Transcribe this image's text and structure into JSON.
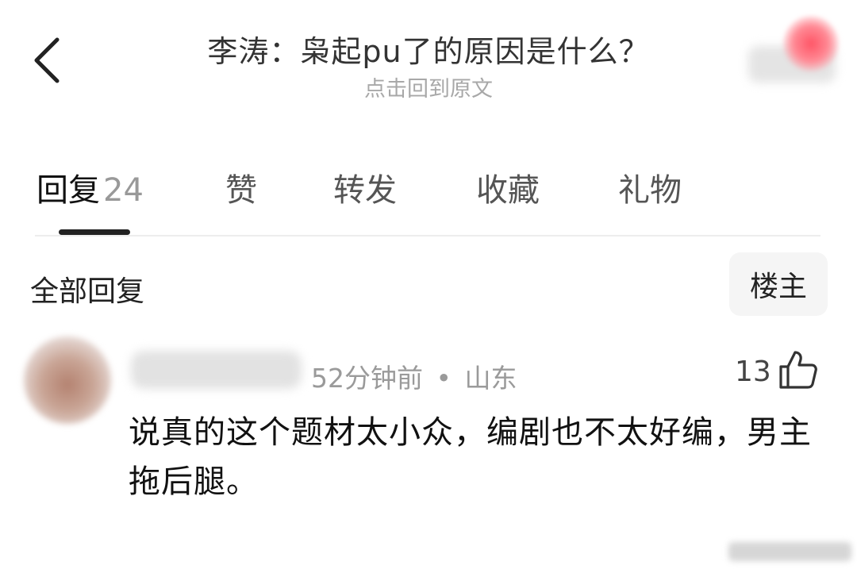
{
  "header": {
    "title": "李涛：枭起pu了的原因是什么？",
    "subtitle": "点击回到原文"
  },
  "tabs": [
    {
      "label": "回复",
      "count": "24"
    },
    {
      "label": "赞"
    },
    {
      "label": "转发"
    },
    {
      "label": "收藏"
    },
    {
      "label": "礼物"
    }
  ],
  "section": {
    "title": "全部回复",
    "op_filter": "楼主"
  },
  "comment": {
    "time": "52分钟前",
    "separator": "•",
    "location": "山东",
    "likes": "13",
    "text": "说真的这个题材太小众，编剧也不太好编，男主拖后腿。"
  },
  "icons": {
    "back": "chevron-left-icon",
    "like": "thumbs-up-icon"
  }
}
